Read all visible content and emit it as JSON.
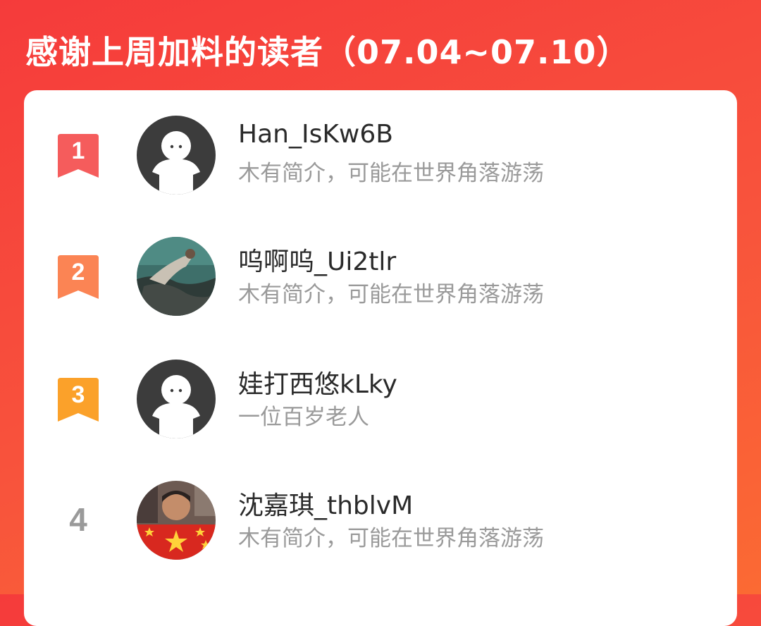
{
  "header": {
    "title": "感谢上周加料的读者（07.04~07.10）"
  },
  "readers": [
    {
      "rank": "1",
      "name": "Han_IsKw6B",
      "bio": "木有简介，可能在世界角落游荡",
      "badge_color": "#f55c5c",
      "avatar": "default-avatar"
    },
    {
      "rank": "2",
      "name": "呜啊呜_Ui2tlr",
      "bio": "木有简介，可能在世界角落游荡",
      "badge_color": "#fb8454",
      "avatar": "photo-underwater"
    },
    {
      "rank": "3",
      "name": "娃打西悠kLky",
      "bio": "一位百岁老人",
      "badge_color": "#fba12a",
      "avatar": "default-avatar"
    },
    {
      "rank": "4",
      "name": "沈嘉琪_thblvM",
      "bio": "木有简介，可能在世界角落游荡",
      "badge_color": "",
      "avatar": "photo-flag"
    }
  ]
}
